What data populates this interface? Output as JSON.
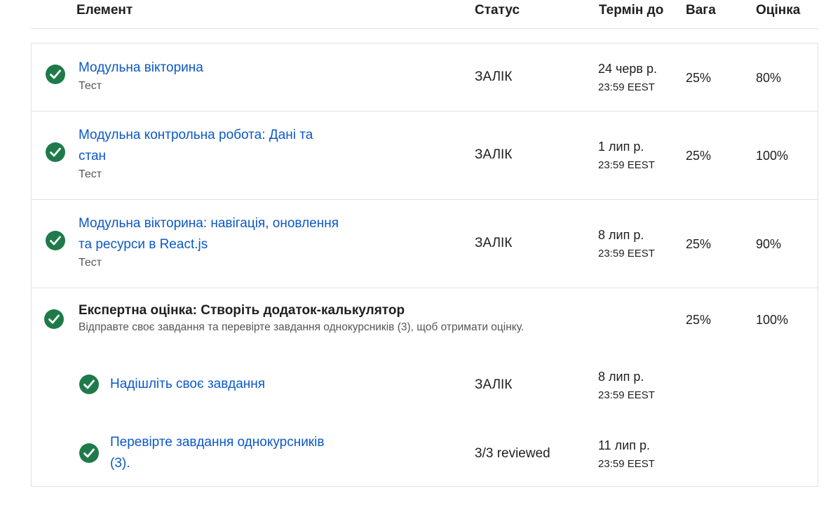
{
  "header": {
    "item": "Елемент",
    "status": "Статус",
    "due": "Термін до",
    "weight": "Вага",
    "grade": "Оцінка"
  },
  "rows": [
    {
      "title": "Модульна вікторина",
      "type": "Тест",
      "status": "ЗАЛІК",
      "due_date": "24 черв р.",
      "due_time": "23:59 EEST",
      "weight": "25%",
      "grade": "80%"
    },
    {
      "title_line1": "Модульна контрольна робота: Дані та",
      "title_line2": "стан",
      "type": "Тест",
      "status": "ЗАЛІК",
      "due_date": "1 лип р.",
      "due_time": "23:59 EEST",
      "weight": "25%",
      "grade": "100%"
    },
    {
      "title_line1": "Модульна вікторина: навігація, оновлення",
      "title_line2": "та ресурси в React.js",
      "type": "Тест",
      "status": "ЗАЛІК",
      "due_date": "8 лип р.",
      "due_time": "23:59 EEST",
      "weight": "25%",
      "grade": "90%"
    },
    {
      "title": "Експертна оцінка: Створіть додаток-калькулятор",
      "description": "Відправте своє завдання та перевірте завдання однокурсників (3), щоб отримати оцінку.",
      "weight": "25%",
      "grade": "100%",
      "subitems": [
        {
          "title": "Надішліть своє завдання",
          "status": "ЗАЛІК",
          "due_date": "8 лип р.",
          "due_time": "23:59 EEST"
        },
        {
          "title_line1": "Перевірте завдання однокурсників",
          "title_line2": "(3).",
          "status": "3/3 reviewed",
          "due_date": "11 лип р.",
          "due_time": "23:59 EEST"
        }
      ]
    }
  ],
  "icons": {
    "completed": "check-circle-icon"
  },
  "colors": {
    "link": "#0b58c9",
    "success": "#1f7a4a",
    "border": "#e1e1e1"
  }
}
